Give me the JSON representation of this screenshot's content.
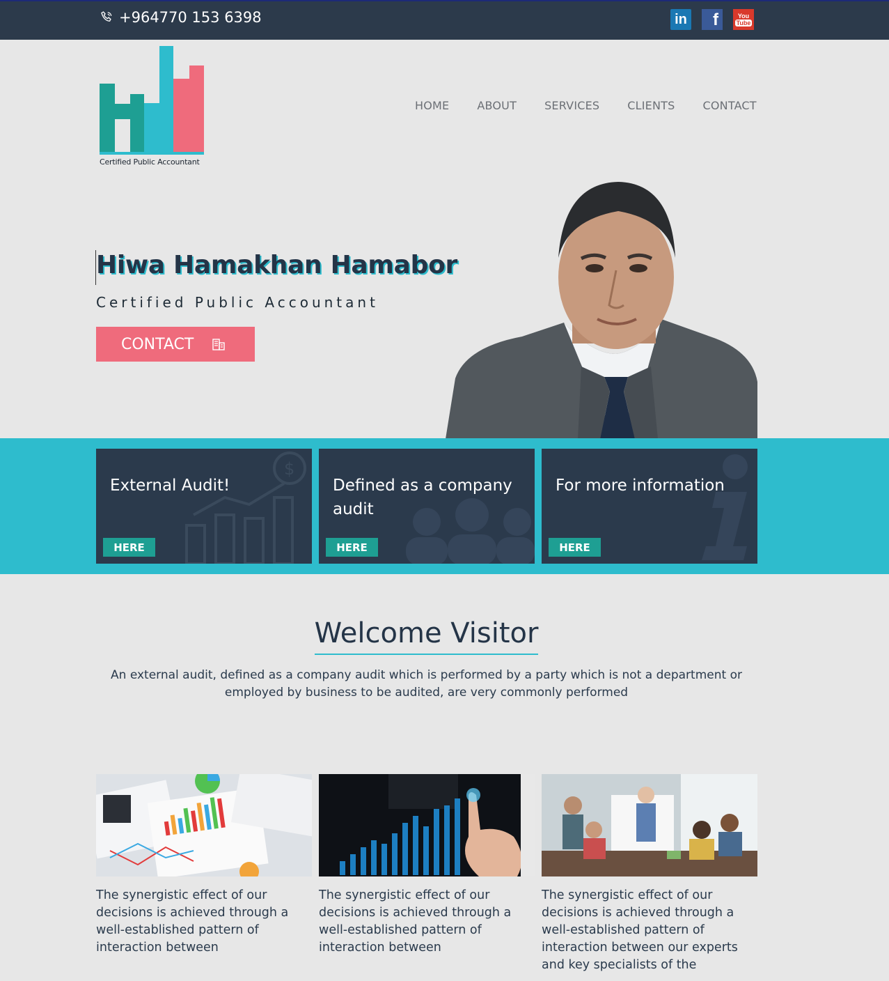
{
  "topbar": {
    "phone": "+964770 153 6398",
    "social": [
      "linkedin-icon",
      "facebook-icon",
      "youtube-icon"
    ]
  },
  "logo": {
    "caption": "Certified Public Accountant",
    "colors": [
      "#1e9f93",
      "#2ebccd",
      "#ef6b7c"
    ]
  },
  "nav": {
    "items": [
      "HOME",
      "ABOUT",
      "SERVICES",
      "CLIENTS",
      "CONTACT"
    ]
  },
  "hero": {
    "name": "Hiwa Hamakhan Hamabor",
    "subtitle": "Certified Public Accountant",
    "contact_label": "CONTACT"
  },
  "cards": [
    {
      "title": "External Audit!",
      "button": "HERE",
      "icon": "growth-chart-icon"
    },
    {
      "title": "Defined as a company audit",
      "button": "HERE",
      "icon": "people-group-icon"
    },
    {
      "title": "For more information",
      "button": "HERE",
      "icon": "info-icon"
    }
  ],
  "welcome": {
    "heading": "Welcome Visitor",
    "intro": "An external audit, defined as a company audit which is performed by a party which is not a department or employed by business to be audited, are very commonly performed"
  },
  "columns": [
    {
      "image": "financial-charts-photo",
      "text": "The synergistic effect of our decisions is achieved through a well-established pattern of interaction between"
    },
    {
      "image": "touch-growth-chart-photo",
      "text": "The synergistic effect of our decisions is achieved through a well-established pattern of interaction between"
    },
    {
      "image": "team-meeting-photo",
      "text": "The synergistic effect of our decisions is achieved through a well-established pattern of interaction between our experts and key specialists of the"
    }
  ],
  "colors": {
    "topbar": "#2c3a4b",
    "accent": "#2ebccd",
    "pink": "#ef6b7c",
    "card": "#2b3a4c",
    "teal": "#1e9f93"
  }
}
